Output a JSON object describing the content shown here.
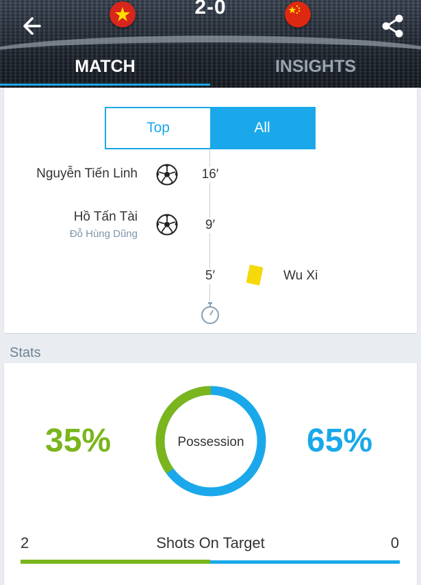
{
  "header": {
    "score": "2-0",
    "home_flag": "vietnam-flag",
    "away_flag": "china-flag",
    "tabs": [
      {
        "label": "MATCH",
        "active": true
      },
      {
        "label": "INSIGHTS",
        "active": false
      }
    ]
  },
  "filter": {
    "options": [
      {
        "label": "Top",
        "selected": false
      },
      {
        "label": "All",
        "selected": true
      }
    ]
  },
  "events": [
    {
      "side": "home",
      "type": "goal",
      "player": "Nguyễn Tiến Linh",
      "assist": "",
      "minute": "16′"
    },
    {
      "side": "home",
      "type": "goal",
      "player": "Hồ Tấn Tài",
      "assist": "Đỗ Hùng Dũng",
      "minute": "9′"
    },
    {
      "side": "away",
      "type": "yellow-card",
      "player": "Wu Xi",
      "assist": "",
      "minute": "5′"
    }
  ],
  "stats": {
    "section_title": "Stats",
    "possession": {
      "label": "Possession",
      "home": "35%",
      "away": "65%",
      "home_value": 35,
      "away_value": 65
    },
    "shots_on_target": {
      "label": "Shots On Target",
      "home": "2",
      "away": "0",
      "home_value": 2,
      "away_value": 0
    }
  },
  "colors": {
    "accent_blue": "#1aa8ea",
    "home_green": "#7ab51d",
    "yellow_card": "#f5d90a"
  }
}
